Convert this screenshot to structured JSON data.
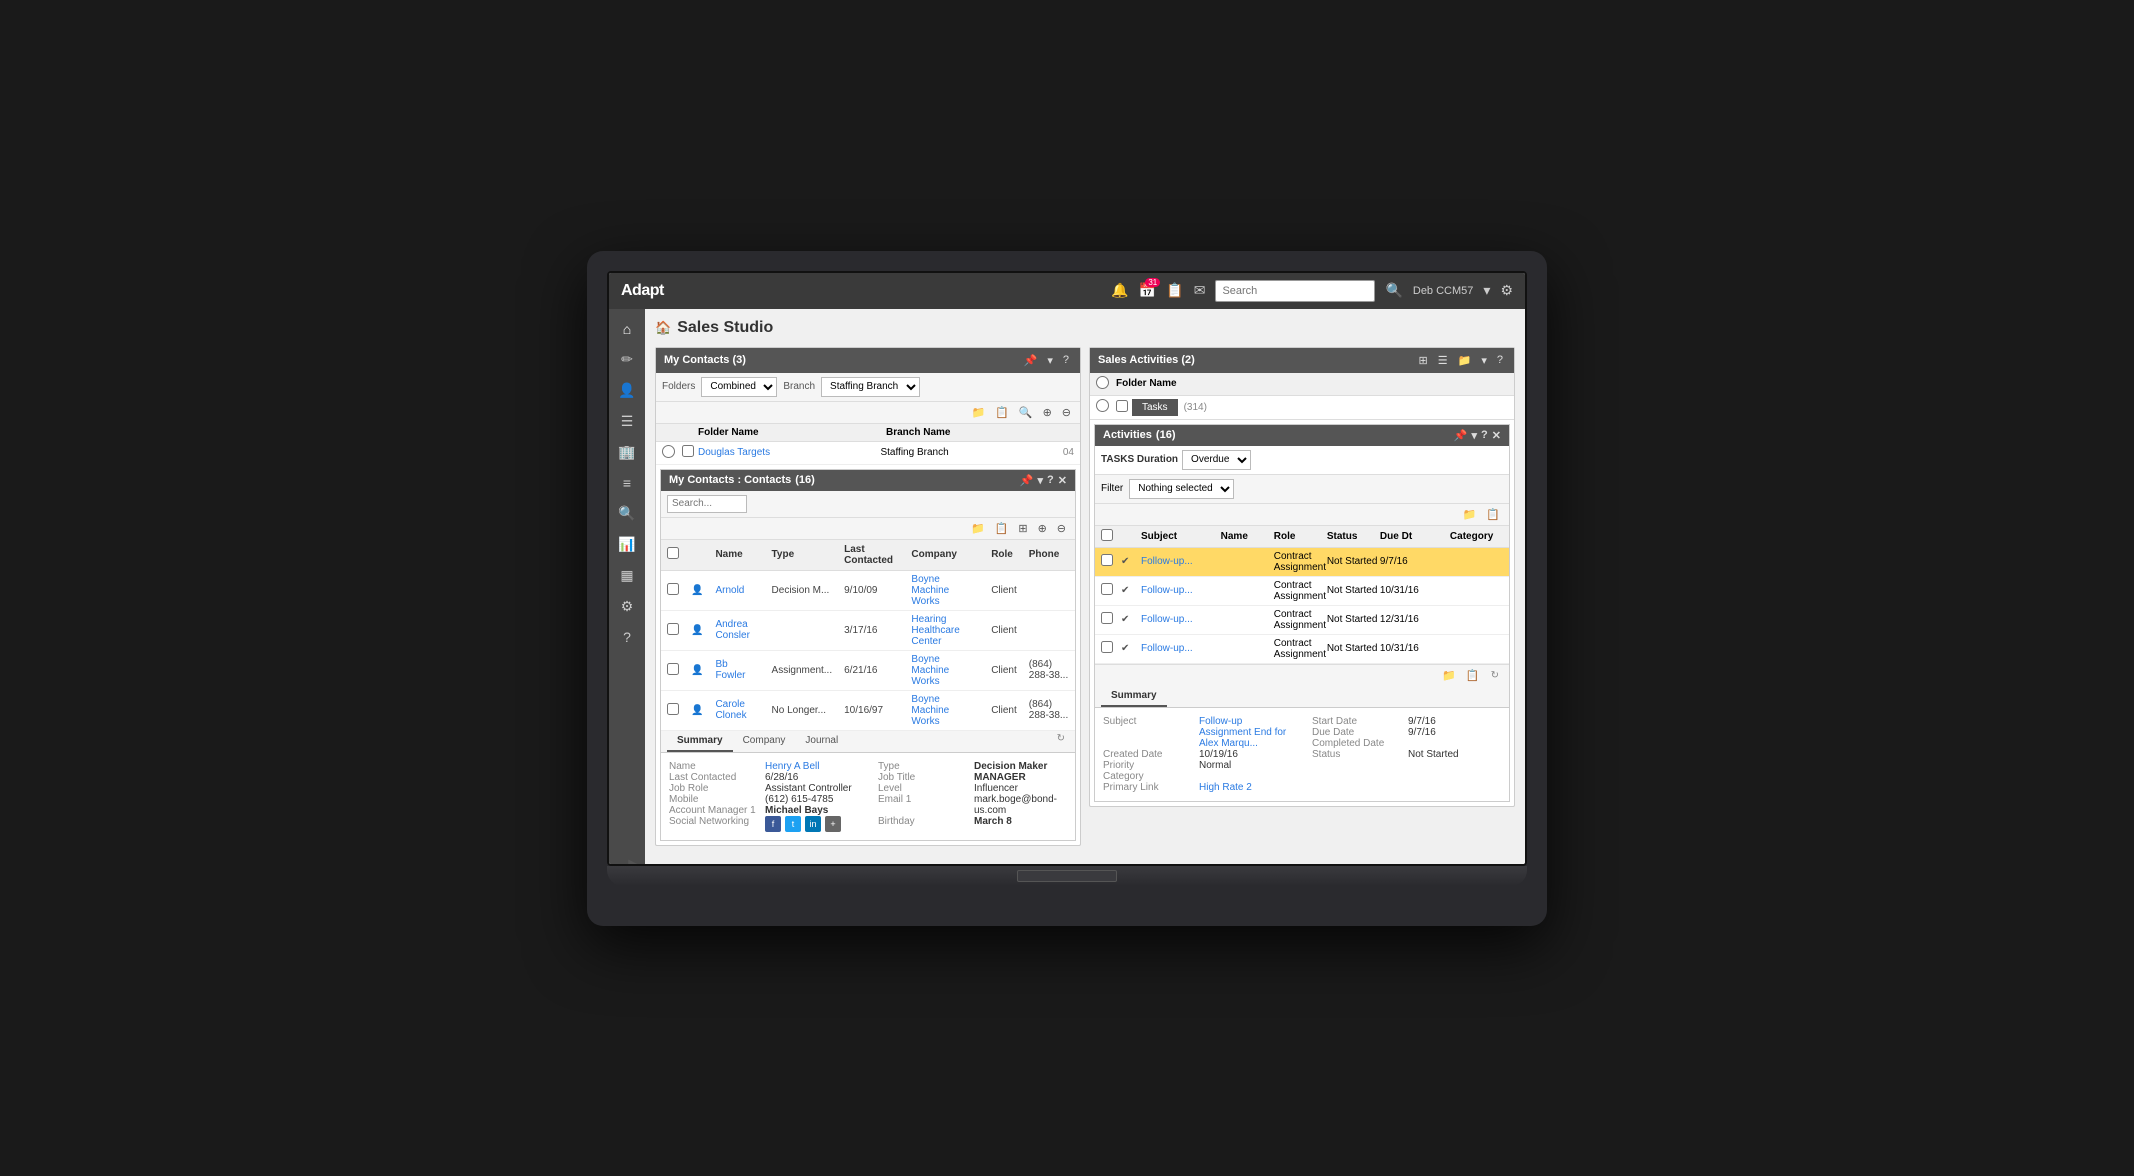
{
  "app": {
    "name": "Adapt",
    "page_title": "Sales Studio"
  },
  "top_nav": {
    "search_placeholder": "Search",
    "user": "Deb CCM57",
    "badge_count": "31"
  },
  "sidebar": {
    "icons": [
      "home",
      "edit",
      "person",
      "list",
      "building",
      "menu",
      "search",
      "chart",
      "table",
      "settings",
      "help"
    ]
  },
  "my_contacts": {
    "title": "My Contacts",
    "count": "(3)",
    "folders_label": "Folders",
    "folder_value": "Combined",
    "branch_label": "Branch",
    "branch_value": "Staffing Branch",
    "col_folder_name": "Folder Name",
    "col_branch_name": "Branch Name",
    "rows": [
      {
        "name": "Douglas Targets",
        "branch": "Staffing Branch",
        "count": "04"
      }
    ]
  },
  "contacts_inner": {
    "title": "My Contacts : Contacts",
    "count": "(16)",
    "columns": [
      "Name",
      "Type",
      "Last Contacted",
      "Company",
      "Role",
      "Phone"
    ],
    "rows": [
      {
        "name": "Arnold",
        "type": "Decision M...",
        "last_contacted": "9/10/09",
        "company": "Boyne Machine Works",
        "role": "Client",
        "phone": ""
      },
      {
        "name": "Andrea Consler",
        "type": "",
        "last_contacted": "3/17/16",
        "company": "Hearing Healthcare Center",
        "role": "Client",
        "phone": ""
      },
      {
        "name": "Bb Fowler",
        "type": "Assignment...",
        "last_contacted": "6/21/16",
        "company": "Boyne Machine Works",
        "role": "Client",
        "phone": "(864) 288-38..."
      },
      {
        "name": "Carole Clonek",
        "type": "No Longer...",
        "last_contacted": "10/16/97",
        "company": "Boyne Machine Works",
        "role": "Client",
        "phone": "(864) 288-38..."
      }
    ],
    "tabs": [
      "Summary",
      "Company",
      "Journal"
    ],
    "detail": {
      "name_label": "Name",
      "name_value": "Henry A Bell",
      "last_contacted_label": "Last Contacted",
      "last_contacted_value": "6/28/16",
      "job_role_label": "Job Role",
      "job_role_value": "Assistant Controller",
      "mobile_label": "Mobile",
      "mobile_value": "(612) 615-4785",
      "account_mgr_label": "Account Manager 1",
      "account_mgr_value": "Michael Bays",
      "social_label": "Social Networking",
      "type_label": "Type",
      "type_value": "Decision Maker",
      "job_title_label": "Job Title",
      "job_title_value": "MANAGER",
      "level_label": "Level",
      "level_value": "Influencer",
      "email_label": "Email 1",
      "email_value": "mark.boge@bond-us.com",
      "birthday_label": "Birthday",
      "birthday_value": "March 8"
    }
  },
  "sales_activities": {
    "title": "Sales Activities",
    "count": "(2)",
    "folder_name": "Folder Name",
    "tasks_label": "Tasks",
    "tasks_count": "(314)",
    "activities_title": "Activities",
    "activities_count": "(16)",
    "duration_label": "TASKS Duration",
    "duration_value": "Overdue",
    "filter_label": "Filter",
    "filter_value": "Nothing selected",
    "columns": [
      "Subject",
      "Name",
      "Role",
      "Status",
      "Due Dt",
      "Category"
    ],
    "rows": [
      {
        "subject": "Follow-up...",
        "icon": true,
        "name": "",
        "role": "Contract Assignment",
        "status": "Not Started",
        "due_dt": "9/7/16",
        "category": "",
        "highlighted": true
      },
      {
        "subject": "Follow-up...",
        "icon": true,
        "name": "",
        "role": "Contract Assignment",
        "status": "Not Started",
        "due_dt": "10/31/16",
        "category": "",
        "highlighted": false
      },
      {
        "subject": "Follow-up...",
        "icon": true,
        "name": "",
        "role": "Contract Assignment",
        "status": "Not Started",
        "due_dt": "12/31/16",
        "category": "",
        "highlighted": false
      },
      {
        "subject": "Follow-up...",
        "icon": true,
        "name": "",
        "role": "Contract Assignment",
        "status": "Not Started",
        "due_dt": "10/31/16",
        "category": "",
        "highlighted": false
      }
    ],
    "summary_tab": "Summary",
    "summary": {
      "subject_label": "Subject",
      "subject_value": "Follow-up Assignment End for Alex Marqu...",
      "start_date_label": "Start Date",
      "start_date_value": "9/7/16",
      "created_label": "Created Date",
      "created_value": "10/19/16",
      "due_date_label": "Due Date",
      "due_date_value": "9/7/16",
      "priority_label": "Priority",
      "priority_value": "Normal",
      "completed_label": "Completed Date",
      "completed_value": "",
      "category_label": "Category",
      "category_value": "",
      "status_label": "Status",
      "status_value": "Not Started",
      "primary_link_label": "Primary Link",
      "primary_link_value": "High Rate 2"
    }
  }
}
